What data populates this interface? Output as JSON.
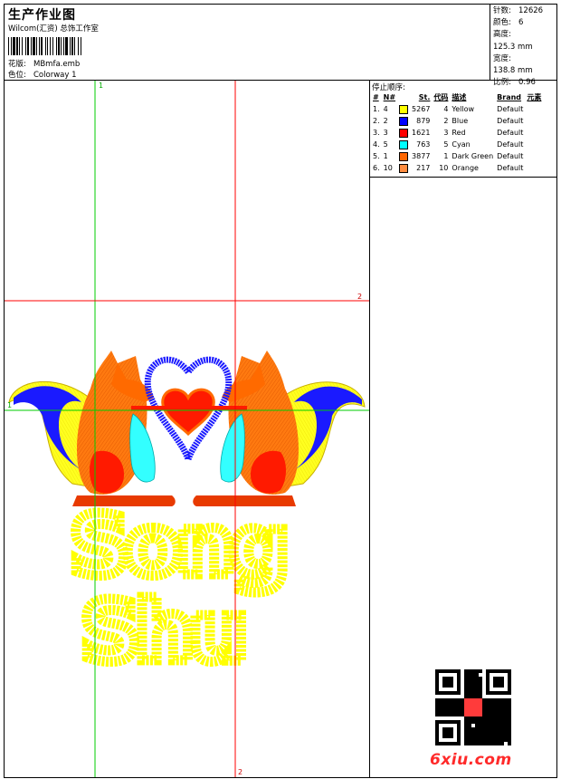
{
  "header": {
    "title": "生产作业图",
    "subtitle": "Wilcom(汇资) 总饰工作室",
    "design_label": "花版:",
    "design_value": "MBmfa.emb",
    "colorway_label": "色位:",
    "colorway_value": "Colorway 1"
  },
  "stats": [
    {
      "label": "针数:",
      "value": "12626"
    },
    {
      "label": "颜色:",
      "value": "6"
    },
    {
      "label": "高度:",
      "value": "125.3 mm"
    },
    {
      "label": "宽度:",
      "value": "138.8 mm"
    },
    {
      "label": "比例:",
      "value": "0.96"
    }
  ],
  "stops": {
    "title": "停止顺序:",
    "headers": [
      "#",
      "N#",
      "",
      "St.",
      "代码",
      "描述",
      "Brand",
      "元素"
    ],
    "rows": [
      {
        "n": "1.",
        "needle": "4",
        "color": "#ffff00",
        "st": "5267",
        "code": "4",
        "desc": "Yellow",
        "brand": "Default"
      },
      {
        "n": "2.",
        "needle": "2",
        "color": "#0000ff",
        "st": "879",
        "code": "2",
        "desc": "Blue",
        "brand": "Default"
      },
      {
        "n": "3.",
        "needle": "3",
        "color": "#ff0000",
        "st": "1621",
        "code": "3",
        "desc": "Red",
        "brand": "Default"
      },
      {
        "n": "4.",
        "needle": "5",
        "color": "#00ffff",
        "st": "763",
        "code": "5",
        "desc": "Cyan",
        "brand": "Default"
      },
      {
        "n": "5.",
        "needle": "1",
        "color": "#ff6600",
        "st": "3877",
        "code": "1",
        "desc": "Dark Green",
        "brand": "Default"
      },
      {
        "n": "6.",
        "needle": "10",
        "color": "#ff8c40",
        "st": "217",
        "code": "10",
        "desc": "Orange",
        "brand": "Default"
      }
    ]
  },
  "design": {
    "text_line1": "Song",
    "text_line2": "Shu",
    "guide_v_green": "1",
    "guide_v_red": "2",
    "guide_h_red": "2",
    "guide_h_green": "1"
  },
  "watermark": "6xiu.com",
  "colors": {
    "orange": "#ff6a00",
    "yellow": "#ffff00",
    "blue": "#1a1aff",
    "red": "#ff1a00",
    "cyan": "#33ffff",
    "guide_red": "#ff0000",
    "guide_green": "#00cc00",
    "watermark": "#ff2a2a"
  }
}
